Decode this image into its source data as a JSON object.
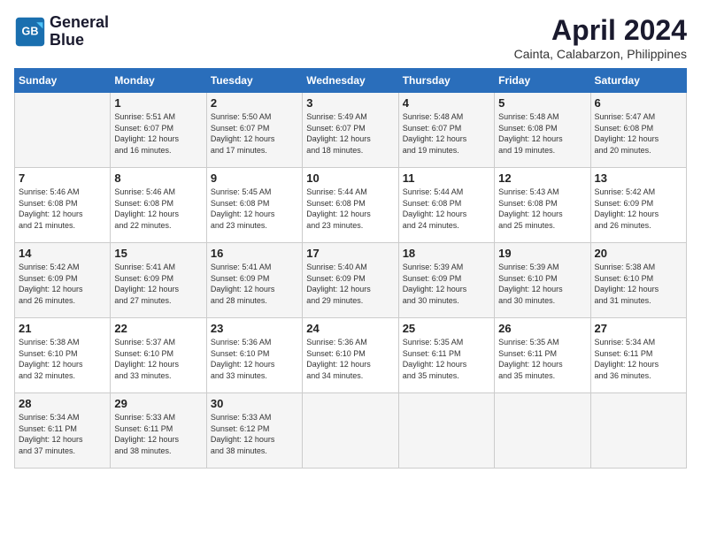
{
  "logo": {
    "line1": "General",
    "line2": "Blue"
  },
  "title": "April 2024",
  "location": "Cainta, Calabarzon, Philippines",
  "days_of_week": [
    "Sunday",
    "Monday",
    "Tuesday",
    "Wednesday",
    "Thursday",
    "Friday",
    "Saturday"
  ],
  "weeks": [
    [
      {
        "num": "",
        "info": ""
      },
      {
        "num": "1",
        "info": "Sunrise: 5:51 AM\nSunset: 6:07 PM\nDaylight: 12 hours\nand 16 minutes."
      },
      {
        "num": "2",
        "info": "Sunrise: 5:50 AM\nSunset: 6:07 PM\nDaylight: 12 hours\nand 17 minutes."
      },
      {
        "num": "3",
        "info": "Sunrise: 5:49 AM\nSunset: 6:07 PM\nDaylight: 12 hours\nand 18 minutes."
      },
      {
        "num": "4",
        "info": "Sunrise: 5:48 AM\nSunset: 6:07 PM\nDaylight: 12 hours\nand 19 minutes."
      },
      {
        "num": "5",
        "info": "Sunrise: 5:48 AM\nSunset: 6:08 PM\nDaylight: 12 hours\nand 19 minutes."
      },
      {
        "num": "6",
        "info": "Sunrise: 5:47 AM\nSunset: 6:08 PM\nDaylight: 12 hours\nand 20 minutes."
      }
    ],
    [
      {
        "num": "7",
        "info": "Sunrise: 5:46 AM\nSunset: 6:08 PM\nDaylight: 12 hours\nand 21 minutes."
      },
      {
        "num": "8",
        "info": "Sunrise: 5:46 AM\nSunset: 6:08 PM\nDaylight: 12 hours\nand 22 minutes."
      },
      {
        "num": "9",
        "info": "Sunrise: 5:45 AM\nSunset: 6:08 PM\nDaylight: 12 hours\nand 23 minutes."
      },
      {
        "num": "10",
        "info": "Sunrise: 5:44 AM\nSunset: 6:08 PM\nDaylight: 12 hours\nand 23 minutes."
      },
      {
        "num": "11",
        "info": "Sunrise: 5:44 AM\nSunset: 6:08 PM\nDaylight: 12 hours\nand 24 minutes."
      },
      {
        "num": "12",
        "info": "Sunrise: 5:43 AM\nSunset: 6:08 PM\nDaylight: 12 hours\nand 25 minutes."
      },
      {
        "num": "13",
        "info": "Sunrise: 5:42 AM\nSunset: 6:09 PM\nDaylight: 12 hours\nand 26 minutes."
      }
    ],
    [
      {
        "num": "14",
        "info": "Sunrise: 5:42 AM\nSunset: 6:09 PM\nDaylight: 12 hours\nand 26 minutes."
      },
      {
        "num": "15",
        "info": "Sunrise: 5:41 AM\nSunset: 6:09 PM\nDaylight: 12 hours\nand 27 minutes."
      },
      {
        "num": "16",
        "info": "Sunrise: 5:41 AM\nSunset: 6:09 PM\nDaylight: 12 hours\nand 28 minutes."
      },
      {
        "num": "17",
        "info": "Sunrise: 5:40 AM\nSunset: 6:09 PM\nDaylight: 12 hours\nand 29 minutes."
      },
      {
        "num": "18",
        "info": "Sunrise: 5:39 AM\nSunset: 6:09 PM\nDaylight: 12 hours\nand 30 minutes."
      },
      {
        "num": "19",
        "info": "Sunrise: 5:39 AM\nSunset: 6:10 PM\nDaylight: 12 hours\nand 30 minutes."
      },
      {
        "num": "20",
        "info": "Sunrise: 5:38 AM\nSunset: 6:10 PM\nDaylight: 12 hours\nand 31 minutes."
      }
    ],
    [
      {
        "num": "21",
        "info": "Sunrise: 5:38 AM\nSunset: 6:10 PM\nDaylight: 12 hours\nand 32 minutes."
      },
      {
        "num": "22",
        "info": "Sunrise: 5:37 AM\nSunset: 6:10 PM\nDaylight: 12 hours\nand 33 minutes."
      },
      {
        "num": "23",
        "info": "Sunrise: 5:36 AM\nSunset: 6:10 PM\nDaylight: 12 hours\nand 33 minutes."
      },
      {
        "num": "24",
        "info": "Sunrise: 5:36 AM\nSunset: 6:10 PM\nDaylight: 12 hours\nand 34 minutes."
      },
      {
        "num": "25",
        "info": "Sunrise: 5:35 AM\nSunset: 6:11 PM\nDaylight: 12 hours\nand 35 minutes."
      },
      {
        "num": "26",
        "info": "Sunrise: 5:35 AM\nSunset: 6:11 PM\nDaylight: 12 hours\nand 35 minutes."
      },
      {
        "num": "27",
        "info": "Sunrise: 5:34 AM\nSunset: 6:11 PM\nDaylight: 12 hours\nand 36 minutes."
      }
    ],
    [
      {
        "num": "28",
        "info": "Sunrise: 5:34 AM\nSunset: 6:11 PM\nDaylight: 12 hours\nand 37 minutes."
      },
      {
        "num": "29",
        "info": "Sunrise: 5:33 AM\nSunset: 6:11 PM\nDaylight: 12 hours\nand 38 minutes."
      },
      {
        "num": "30",
        "info": "Sunrise: 5:33 AM\nSunset: 6:12 PM\nDaylight: 12 hours\nand 38 minutes."
      },
      {
        "num": "",
        "info": ""
      },
      {
        "num": "",
        "info": ""
      },
      {
        "num": "",
        "info": ""
      },
      {
        "num": "",
        "info": ""
      }
    ]
  ]
}
